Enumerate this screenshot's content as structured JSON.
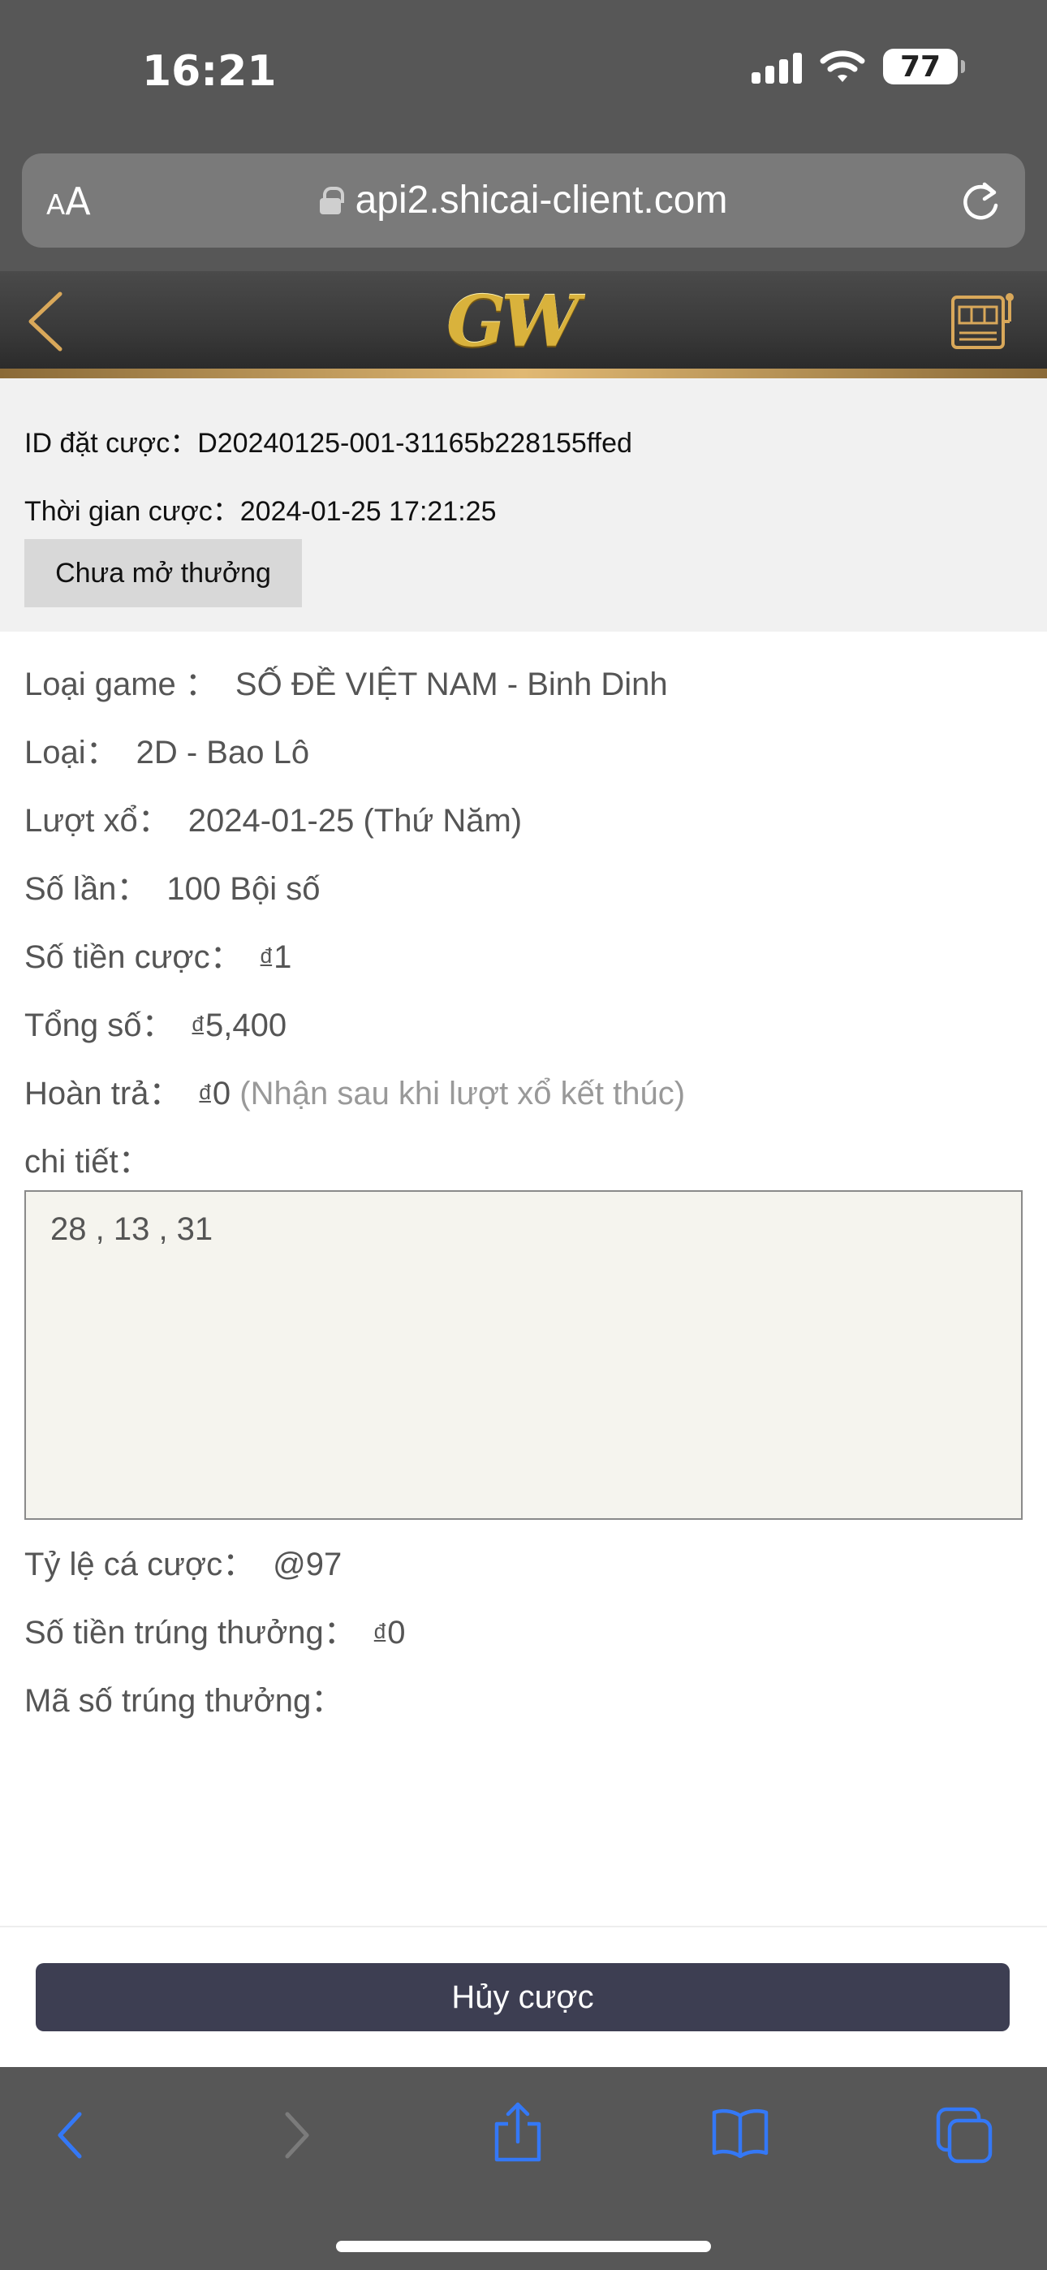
{
  "status_bar": {
    "time": "16:21",
    "battery": "77"
  },
  "browser": {
    "text_size_label": "AA",
    "url": "api2.shicai-client.com"
  },
  "header": {
    "logo_text": "GW"
  },
  "bet": {
    "id_label": "ID đặt cược：",
    "id_value": "D20240125-001-31165b228155ffed",
    "time_label": "Thời gian cược：",
    "time_value": "2024-01-25 17:21:25",
    "status": "Chưa mở thưởng"
  },
  "details": {
    "game_type_label": "Loại game ：",
    "game_type_value": "SỐ ĐỀ VIỆT NAM - Binh Dinh",
    "type_label": "Loại：",
    "type_value": "2D - Bao Lô",
    "draw_label": "Lượt xổ：",
    "draw_value": "2024-01-25 (Thứ Năm)",
    "times_label": "Số lần：",
    "times_value": "100 Bội số",
    "bet_amount_label": "Số tiền cược：",
    "currency_symbol": "đ",
    "bet_amount_value": "1",
    "total_label": "Tổng số：",
    "total_value": "5,400",
    "refund_label": "Hoàn trả：",
    "refund_value": "0",
    "refund_note": "(Nhận sau khi lượt xổ kết thúc)",
    "detail_label": "chi tiết：",
    "detail_numbers": "28 , 13 , 31",
    "odds_label": "Tỷ lệ cá cược：",
    "odds_value": "@97",
    "winnings_label": "Số tiền trúng thưởng：",
    "winnings_value": "0",
    "winning_numbers_label": "Mã số trúng thưởng："
  },
  "actions": {
    "cancel_label": "Hủy cược"
  },
  "colors": {
    "accent_gold": "#d9b23c",
    "ios_blue": "#3478f6",
    "button_dark": "#3d3e52"
  }
}
